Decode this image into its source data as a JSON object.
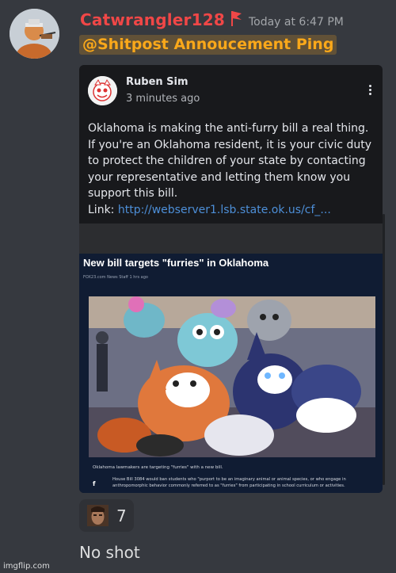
{
  "message": {
    "username": "Catwrangler128",
    "timestamp": "Today at 6:47 PM",
    "mention": "@Shitpost Annoucement Ping",
    "role_icon": "red-flag-icon",
    "colors": {
      "username": "#f04747",
      "mention": "#faa81a",
      "background": "#36393f"
    }
  },
  "embed": {
    "author": "Ruben Sim",
    "time": "3 minutes ago",
    "menu_icon": "kebab-menu-icon",
    "body_lines": [
      "Oklahoma is making the anti-furry bill a real thing.",
      "If you're an Oklahoma resident, it is your civic duty to protect the children of your state by contacting your representative and letting them know you support this bill."
    ],
    "link_label": "Link: ",
    "link_text": "http://webserver1.lsb.state.ok.us/cf_...",
    "article": {
      "title": "New bill targets \"furries\" in Oklahoma",
      "byline": "FOX23.com News Staff  1 hrs ago",
      "caption": "Oklahoma lawmakers are targeting \"furries\" with a new bill.",
      "body": "House Bill 3084 would ban students who \"purport to be an imaginary animal or animal species, or who engage in anthropomorphic behavior commonly referred to as \"furries\" from participating in school curriculum or activities.",
      "social_icon": "facebook-icon",
      "photo_icon": "fursuit-photo"
    }
  },
  "reaction": {
    "emoji": "face-emoji",
    "count": "7"
  },
  "reply": {
    "text": "No shot"
  },
  "watermark": "imgflip.com"
}
